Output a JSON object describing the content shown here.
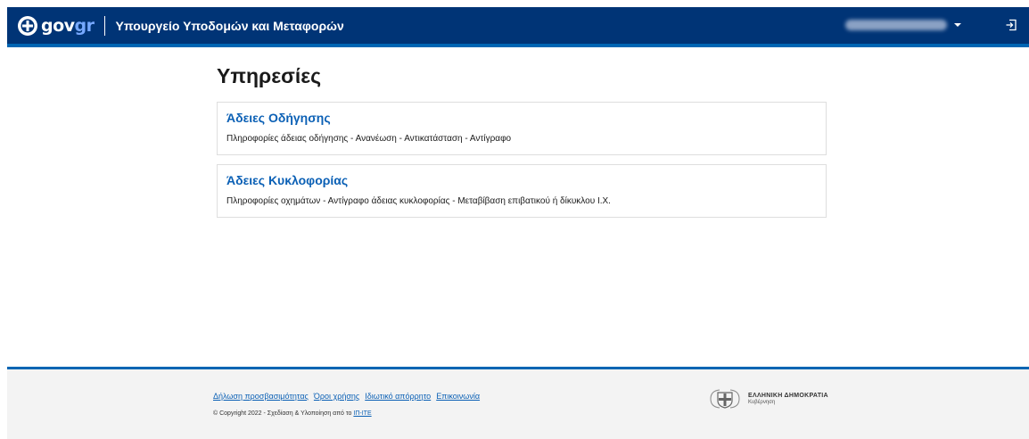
{
  "header": {
    "logo_text_gov": "gov",
    "logo_text_gr": "gr",
    "ministry": "Υπουργείο Υποδομών και Μεταφορών",
    "user_name": "",
    "logout_icon": "logout-icon"
  },
  "main": {
    "title": "Υπηρεσίες",
    "services": [
      {
        "title": "Άδειες Οδήγησης",
        "description": "Πληροφορίες άδειας οδήγησης - Ανανέωση - Αντικατάσταση - Αντίγραφο"
      },
      {
        "title": "Άδειες Κυκλοφορίας",
        "description": "Πληροφορίες οχημάτων - Αντίγραφο άδειας κυκλοφορίας - Μεταβίβαση επιβατικού ή δίκυκλου Ι.Χ."
      }
    ]
  },
  "footer": {
    "links": [
      "Δήλωση προσβασιμότητας",
      "Όροι χρήσης",
      "Ιδιωτικό απόρρητο",
      "Επικοινωνία"
    ],
    "copyright_prefix": "© Copyright 2022 - Σχεδίαση & Υλοποίηση από το",
    "copyright_link": "ΙΠ-ΙΤΕ",
    "gov_logo_title": "ΕΛΛΗΝΙΚΗ ΔΗΜΟΚΡΑΤΙΑ",
    "gov_logo_subtitle": "Κυβέρνηση"
  },
  "colors": {
    "header_bg": "#003476",
    "accent": "#0065b3",
    "link": "#0b60b5",
    "footer_bg": "#f3f3f3"
  }
}
